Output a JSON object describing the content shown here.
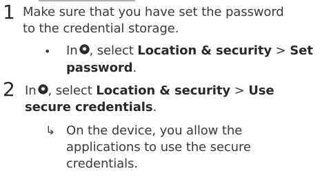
{
  "steps": [
    {
      "number": "1",
      "text_line1": "Make sure that you have set the password",
      "text_line2": "to the credential storage.",
      "substep": {
        "bullet": "•",
        "prefix": "In",
        "comma": ", select",
        "bold1": "Location & security",
        "separator": ">",
        "bold2": "Set",
        "bold2_cont": "password",
        "period": "."
      }
    },
    {
      "number": "2",
      "prefix": "In",
      "comma": ", select",
      "bold1": "Location & security",
      "separator": ">",
      "bold2": "Use",
      "bold2_cont": "secure credentials",
      "period": ".",
      "result": {
        "arrow": "↳",
        "line1": "On the device, you allow the",
        "line2": "applications to use the secure",
        "line3": "credentials."
      }
    }
  ],
  "icons": {
    "settings": "gear-icon"
  }
}
